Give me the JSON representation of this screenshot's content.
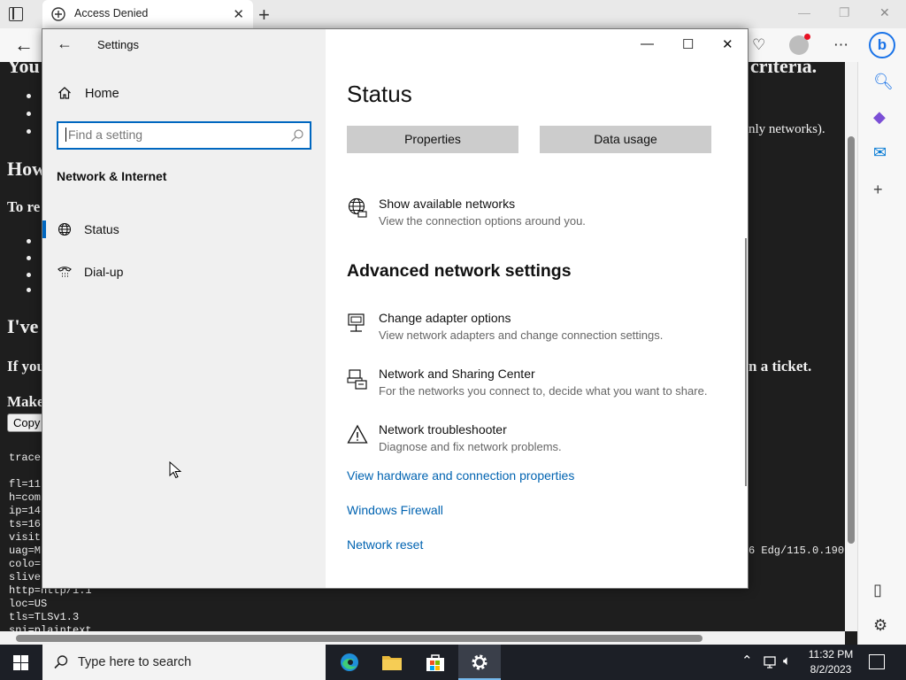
{
  "browser": {
    "tab_title": "Access Denied",
    "webpage": {
      "headings": [
        "You",
        "How",
        "I've"
      ],
      "bold_lines": [
        "To re",
        "If you",
        "Make"
      ],
      "right_fragments": [
        "criteria.",
        "nly networks).",
        "n a ticket.",
        "6 Edg/115.0.190"
      ],
      "copy_button": "Copy",
      "trace_lines": [
        "trace",
        "",
        "fl=11",
        "h=com",
        "ip=14",
        "ts=16",
        "visit",
        "uag=M",
        "colo=",
        "slive",
        "http=http/1.1",
        "loc=US",
        "tls=TLSv1.3",
        "sni=plaintext"
      ]
    }
  },
  "settings": {
    "window_title": "Settings",
    "home_label": "Home",
    "search_placeholder": "Find a setting",
    "section_title": "Network & Internet",
    "nav_items": [
      {
        "label": "Status",
        "selected": true
      },
      {
        "label": "Dial-up",
        "selected": false
      }
    ],
    "page_title": "Status",
    "buttons": {
      "properties": "Properties",
      "data_usage": "Data usage"
    },
    "show_networks": {
      "title": "Show available networks",
      "desc": "View the connection options around you."
    },
    "advanced_heading": "Advanced network settings",
    "advanced_items": [
      {
        "title": "Change adapter options",
        "desc": "View network adapters and change connection settings."
      },
      {
        "title": "Network and Sharing Center",
        "desc": "For the networks you connect to, decide what you want to share."
      },
      {
        "title": "Network troubleshooter",
        "desc": "Diagnose and fix network problems."
      }
    ],
    "links": [
      "View hardware and connection properties",
      "Windows Firewall",
      "Network reset"
    ]
  },
  "taskbar": {
    "search_placeholder": "Type here to search",
    "time": "11:32 PM",
    "date": "8/2/2023"
  },
  "colors": {
    "accent": "#0067c0",
    "link": "#0063b1",
    "taskbar": "#1c1f26"
  }
}
